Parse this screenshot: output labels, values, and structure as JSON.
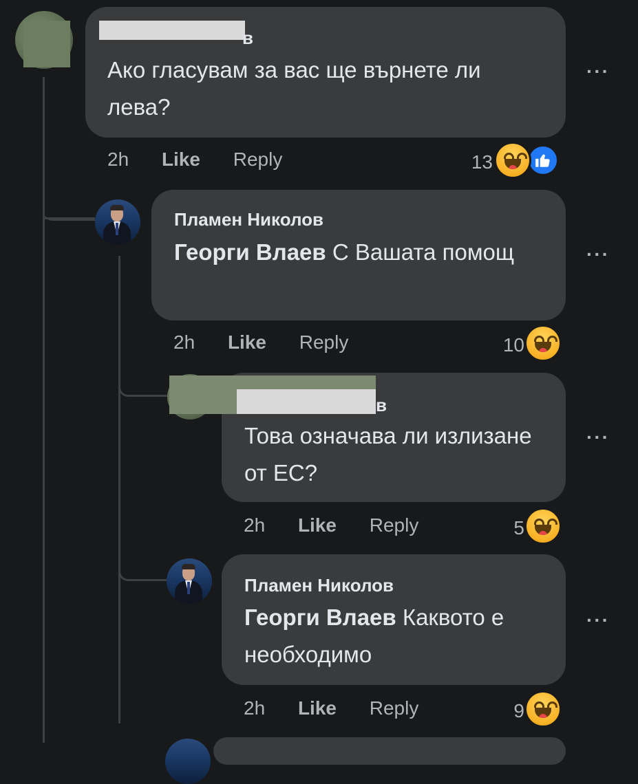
{
  "comments": [
    {
      "author_visible": "в",
      "text": "Ако гласувам за вас ще върнете ли лева?",
      "time": "2h",
      "like_label": "Like",
      "reply_label": "Reply",
      "reaction_count": "13",
      "reactions": [
        "haha-icon",
        "like-icon"
      ]
    },
    {
      "author": "Пламен Николов",
      "mention": "Георги Влаев",
      "text": "С Вашата помощ",
      "time": "2h",
      "like_label": "Like",
      "reply_label": "Reply",
      "reaction_count": "10",
      "reactions": [
        "haha-icon"
      ]
    },
    {
      "author_visible": "в",
      "text": "Това означава ли излизане от ЕС?",
      "time": "2h",
      "like_label": "Like",
      "reply_label": "Reply",
      "reaction_count": "5",
      "reactions": [
        "haha-icon"
      ]
    },
    {
      "author": "Пламен Николов",
      "mention": "Георги Влаев",
      "text": "Каквото е необходимо",
      "time": "2h",
      "like_label": "Like",
      "reply_label": "Reply",
      "reaction_count": "9",
      "reactions": [
        "haha-icon"
      ]
    }
  ],
  "more_options_label": "···",
  "colors": {
    "background": "#18191a",
    "bubble": "#3a3b3c",
    "text": "#e4e6eb",
    "secondary_text": "#b0b3b8",
    "like_blue": "#2078f4",
    "haha_yellow": "#f7b125"
  }
}
